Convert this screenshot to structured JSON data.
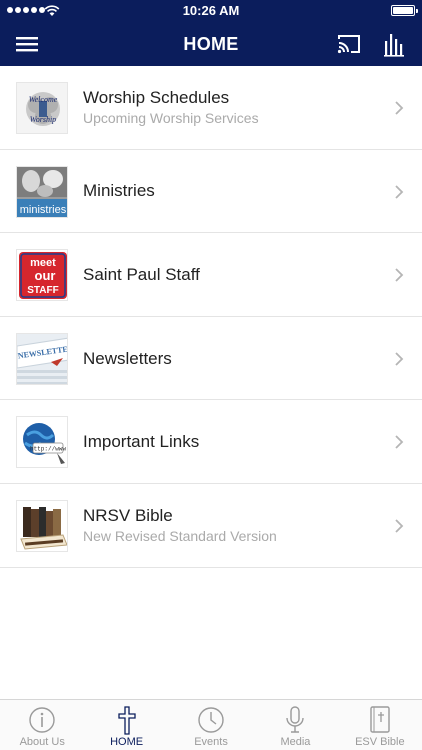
{
  "status_bar": {
    "time": "10:26 AM"
  },
  "header": {
    "title": "HOME"
  },
  "list": [
    {
      "label": "Worship Schedules",
      "sub": "Upcoming Worship Services",
      "thumb": "welcome-worship-image",
      "thumb_text": [
        "Welcome",
        "Worship"
      ]
    },
    {
      "label": "Ministries",
      "sub": "",
      "thumb": "ministries-image",
      "thumb_text": [
        "ministries"
      ]
    },
    {
      "label": "Saint Paul Staff",
      "sub": "",
      "thumb": "meet-our-staff-image",
      "thumb_text": [
        "meet",
        "our",
        "STAFF"
      ]
    },
    {
      "label": "Newsletters",
      "sub": "",
      "thumb": "newsletter-image",
      "thumb_text": [
        "NEWSLETTE"
      ]
    },
    {
      "label": "Important Links",
      "sub": "",
      "thumb": "globe-link-image",
      "thumb_text": [
        "http://www"
      ]
    },
    {
      "label": "NRSV Bible",
      "sub": "New Revised Standard Version",
      "thumb": "bible-books-image",
      "thumb_text": []
    }
  ],
  "tabs": [
    {
      "label": "About Us",
      "icon": "info-icon",
      "active": false
    },
    {
      "label": "HOME",
      "icon": "cross-icon",
      "active": true
    },
    {
      "label": "Events",
      "icon": "clock-icon",
      "active": false
    },
    {
      "label": "Media",
      "icon": "microphone-icon",
      "active": false
    },
    {
      "label": "ESV Bible",
      "icon": "bible-icon",
      "active": false
    }
  ],
  "colors": {
    "header_bg": "#0b1d5c",
    "active_tab": "#0b1d5c",
    "inactive_tab": "#9a9a9a",
    "subtitle": "#aaaaaa"
  }
}
